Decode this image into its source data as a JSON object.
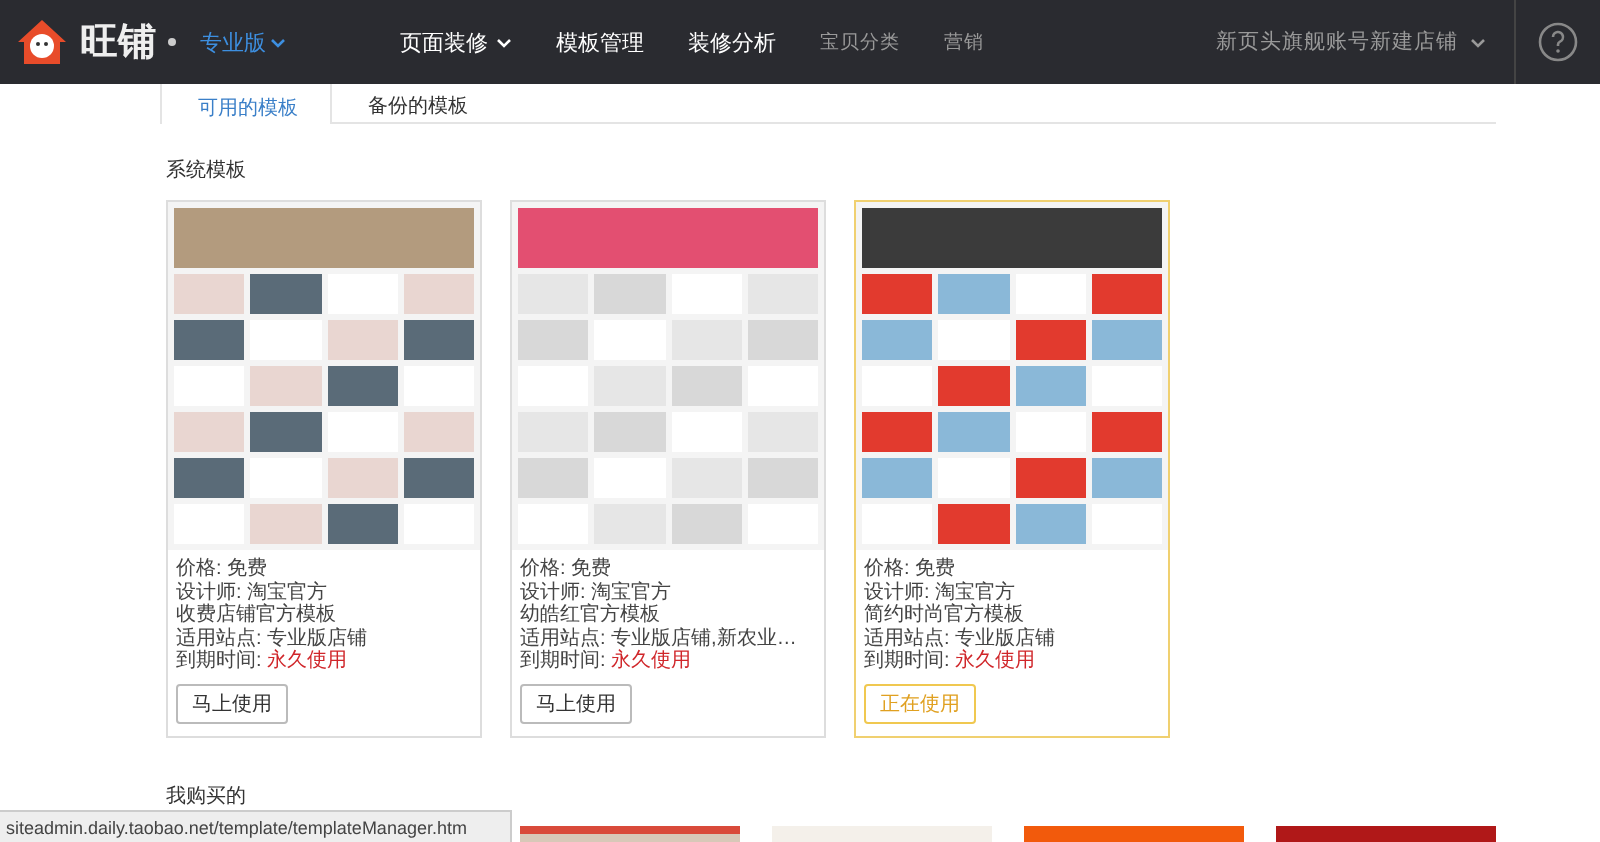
{
  "header": {
    "brand": "旺铺",
    "edition": "专业版",
    "nav": [
      {
        "label": "页面装修",
        "kind": "menu"
      },
      {
        "label": "模板管理",
        "kind": "main"
      },
      {
        "label": "装修分析",
        "kind": "main"
      },
      {
        "label": "宝贝分类",
        "kind": "minor"
      },
      {
        "label": "营销",
        "kind": "minor"
      }
    ],
    "account": "新页头旗舰账号新建店铺"
  },
  "tabs": [
    {
      "label": "可用的模板",
      "selected": true
    },
    {
      "label": "备份的模板",
      "selected": false
    }
  ],
  "system_templates": {
    "title": "系统模板",
    "templates": [
      {
        "price": "价格: 免费",
        "designer": "设计师: 淘宝官方",
        "name": "收费店铺官方模板",
        "sites": "适用站点: 专业版店铺",
        "expiry_label": "到期时间:",
        "expiry": "永久使用",
        "button": "马上使用",
        "in_use": false
      },
      {
        "price": "价格: 免费",
        "designer": "设计师: 淘宝官方",
        "name": "幼皓红官方模板",
        "sites": "适用站点: 专业版店铺,新农业…",
        "expiry_label": "到期时间:",
        "expiry": "永久使用",
        "button": "马上使用",
        "in_use": false
      },
      {
        "price": "价格: 免费",
        "designer": "设计师: 淘宝官方",
        "name": "简约时尚官方模板",
        "sites": "适用站点: 专业版店铺",
        "expiry_label": "到期时间:",
        "expiry": "永久使用",
        "button": "正在使用",
        "in_use": true
      }
    ]
  },
  "purchased": {
    "title": "我购买的"
  },
  "status_bar": "siteadmin.daily.taobao.net/template/templateManager.htm"
}
